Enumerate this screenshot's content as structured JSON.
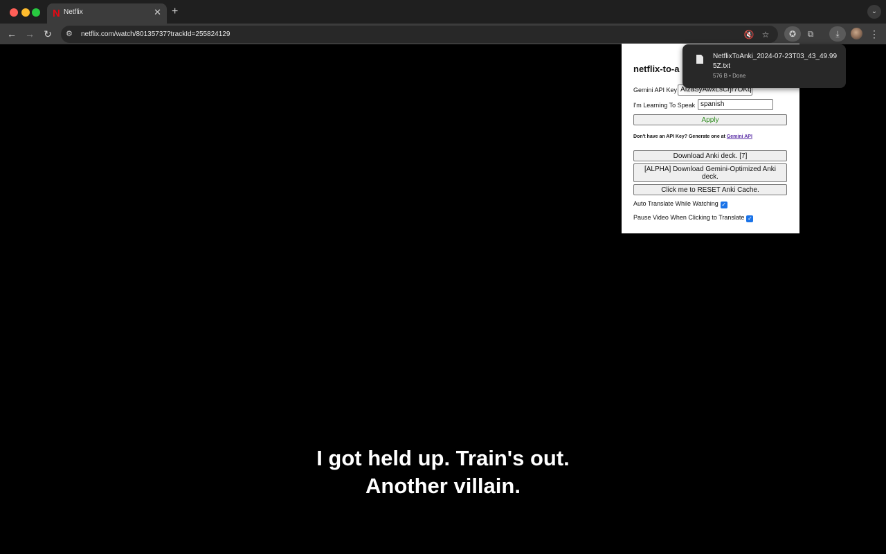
{
  "browser": {
    "tab": {
      "title": "Netflix",
      "favicon": "N",
      "close": "✕"
    },
    "new_tab": "+",
    "url": "netflix.com/watch/80135737?trackId=255824129"
  },
  "subtitles": {
    "line1": "I got held up. Train's out.",
    "line2": "Another villain."
  },
  "popup": {
    "title": "netflix-to-a",
    "api_key_label": "Gemini API Key",
    "api_key_value": "AIzaSyAwxLsCrjr7OKq",
    "language_label": "I'm Learning To Speak",
    "language_value": "spanish",
    "apply_label": "Apply",
    "note_text": "Don't have an API Key? Generate one at",
    "note_link": "Gemini API",
    "download_deck_label": "Download Anki deck. [7]",
    "download_gemini_label": "[ALPHA] Download Gemini-Optimized Anki deck.",
    "reset_label": "Click me to RESET Anki Cache.",
    "auto_translate_label": "Auto Translate While Watching",
    "pause_video_label": "Pause Video When Clicking to Translate",
    "auto_translate_checked": true,
    "pause_video_checked": true
  },
  "download": {
    "file_name": "NetflixToAnki_2024-07-23T03_43_49.995Z.txt",
    "meta": "576 B • Done"
  },
  "colors": {
    "accent": "#1a73e8",
    "netflix_red": "#e50914",
    "apply_green": "#2e8b1e"
  }
}
